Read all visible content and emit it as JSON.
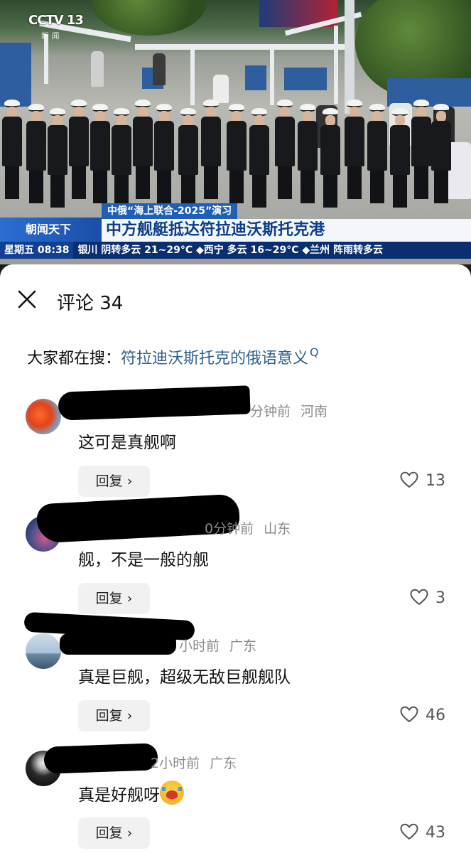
{
  "video": {
    "channel_logo": "CCTV 13",
    "channel_sub": "新 闻",
    "program_name": "朝闻天下",
    "lower_third_tag": "中俄“海上联合-2025”演习",
    "headline": "中方舰艇抵达符拉迪沃斯托克港",
    "ticker_day": "星期五 08:38",
    "ticker_weather": "银川 阴转多云 21~29°C  ◆西宁 多云 16~29°C  ◆兰州 阵雨转多云"
  },
  "sheet": {
    "title": "评论 34",
    "search_prefix": "大家都在搜：",
    "search_query": "符拉迪沃斯托克的俄语意义",
    "search_glyph": "Q"
  },
  "comments": [
    {
      "meta_time": "分钟前",
      "meta_region": "河南",
      "text": "这可是真舰啊",
      "reply_label": "回复 ›",
      "likes": "13"
    },
    {
      "meta_time": "0分钟前",
      "meta_region": "山东",
      "text": "舰，不是一般的舰",
      "reply_label": "回复 ›",
      "likes": "3"
    },
    {
      "meta_time": "小时前",
      "meta_region": "广东",
      "text": "真是巨舰，超级无敌巨舰舰队",
      "reply_label": "回复 ›",
      "likes": "46"
    },
    {
      "meta_time": "2小时前",
      "meta_region": "广东",
      "text": "真是好舰呀",
      "reply_label": "回复 ›",
      "likes": "43"
    }
  ],
  "icons": {
    "close": "close-icon",
    "heart": "heart-icon",
    "emoji": "crying-emoji"
  },
  "colors": {
    "link_blue": "#2f5e8f",
    "news_blue": "#0e3d8a",
    "meta_gray": "#8a8a8a"
  }
}
